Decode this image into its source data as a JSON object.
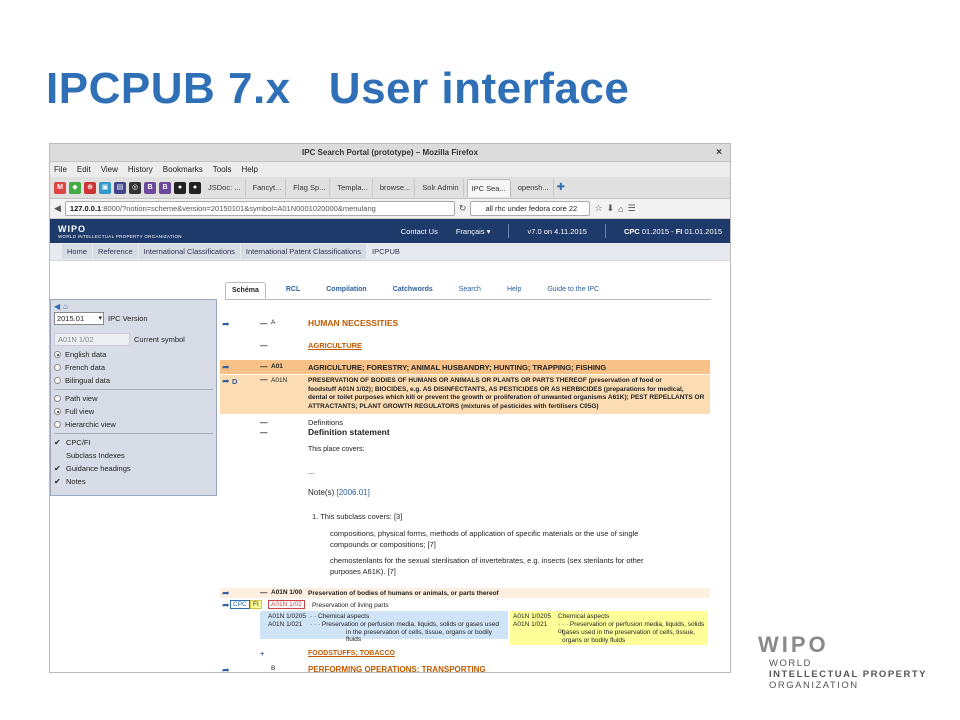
{
  "slide": {
    "title": "IPCPUB 7.x   User interface",
    "logo": {
      "mark": "WIPO",
      "lines": [
        "WORLD",
        "INTELLECTUAL PROPERTY",
        "ORGANIZATION"
      ]
    }
  },
  "window": {
    "title": "IPC Search Portal (prototype) – Mozilla Firefox",
    "close": "×"
  },
  "menubar": [
    "File",
    "Edit",
    "View",
    "History",
    "Bookmarks",
    "Tools",
    "Help"
  ],
  "tabs": [
    "JSDoc: ...",
    "Fancyt...",
    "Flag Sp...",
    "Templa...",
    "browse...",
    "Solr Admin",
    "IPC Sea...",
    "opensh..."
  ],
  "urlbar": {
    "url_host": "127.0.0.1",
    "url_rest": ":8000/?notion=scheme&version=20150101&symbol=A01N0001020000&menulang",
    "search_value": "all rhc under fedora core 22"
  },
  "site_header": {
    "logo": "WIPO",
    "logo_sub": "WORLD INTELLECTUAL PROPERTY ORGANIZATION",
    "contact": "Contact Us",
    "language": "Français ▾",
    "version": "v7.0 on 4.11.2015",
    "cpc_label": "CPC",
    "cpc_value": "01.2015",
    "fi_label": "FI",
    "fi_value": "01.01.2015"
  },
  "breadcrumb": [
    "Home",
    "Reference",
    "International Classifications",
    "International Patent Classifications",
    "IPCPUB"
  ],
  "sidepanel": {
    "version_value": "2015.01",
    "version_label": "IPC Version",
    "symbol_value": "A01N 1/02",
    "symbol_label": "Current symbol",
    "data_options": [
      {
        "label": "English data",
        "selected": true
      },
      {
        "label": "French data",
        "selected": false
      },
      {
        "label": "Bilingual data",
        "selected": false
      }
    ],
    "view_options": [
      {
        "label": "Path view",
        "selected": false
      },
      {
        "label": "Full view",
        "selected": true
      },
      {
        "label": "Hierarchic view",
        "selected": false
      }
    ],
    "checks": [
      {
        "label": "CPC/FI",
        "checked": true
      },
      {
        "label": "Subclass Indexes",
        "checked": false
      },
      {
        "label": "Guidance headings",
        "checked": true
      },
      {
        "label": "Notes",
        "checked": true
      }
    ]
  },
  "subtabs": [
    "Schéma",
    "RCL",
    "Compilation",
    "Catchwords",
    "Search",
    "Help",
    "Guide to the IPC"
  ],
  "scheme": {
    "a_code": "A",
    "a_title": "HUMAN NECESSITIES",
    "agri_title": "AGRICULTURE",
    "a01_code": "A01",
    "a01_title": "AGRICULTURE; FORESTRY; ANIMAL HUSBANDRY; HUNTING; TRAPPING; FISHING",
    "a01n_marker": "D",
    "a01n_code": "A01N",
    "a01n_title_1": "PRESERVATION OF BODIES OF HUMANS OR ANIMALS OR PLANTS OR PARTS THEREOF (preservation of food or",
    "a01n_title_2": "foodstuff A01N 1/02); BIOCIDES, e.g. AS DISINFECTANTS, AS PESTICIDES OR AS HERBICIDES (preparations for medical,",
    "a01n_title_3": "dental or toilet purposes which kill or prevent the growth or proliferation of unwanted organisms A61K); PEST REPELLANTS OR",
    "a01n_title_4": "ATTRACTANTS; PLANT GROWTH REGULATORS (mixtures of pesticides with fertilisers C05G)",
    "definitions": "Definitions",
    "def_statement": "Definition statement",
    "place_covers": "This place covers:",
    "ellipsis": "...",
    "notes": "Note(s)",
    "notes_ref": "[2006.01]",
    "note1": "1. This subclass covers: [3]",
    "note1a": "compositions, physical forms, methods of application of specific materials or the use of single",
    "note1a_2": "compounds or compositions; [7]",
    "note1b": "chemosterilants for the sexual sterilisation of invertebrates, e.g. insects (sex sterilants for other",
    "note1b_2": "purposes A61K). [7]",
    "g100_code": "A01N 1/00",
    "g100_title": "Preservation of bodies of humans or animals, or parts thereof",
    "cpc_tag": "CPC",
    "fi_tag": "FI",
    "g102_code": "A01N 1/02",
    "g102_title": "· Preservation of living parts",
    "cpc_rows": [
      {
        "code": "A01N 1/0205",
        "text": "· · Chemical aspects"
      },
      {
        "code": "A01N 1/021",
        "text": "· · · Preservation or perfusion media, liquids, solids or gases used"
      },
      {
        "code": "",
        "text": "in the preservation of cells, tissue, organs or bodily fluids"
      }
    ],
    "fi_rows": [
      {
        "code": "A01N 1/0205",
        "text": "Chemical aspects"
      },
      {
        "code": "A01N 1/021",
        "text": "· · · Preservation or perfusion media, liquids, solids or"
      },
      {
        "code": "",
        "text": "gases used in the preservation of cells, tissue,"
      },
      {
        "code": "",
        "text": "organs or bodily fluids"
      }
    ],
    "food_title": "FOODSTUFFS; TOBACCO",
    "b_code": "B",
    "b_title": "PERFORMING OPERATIONS; TRANSPORTING"
  }
}
